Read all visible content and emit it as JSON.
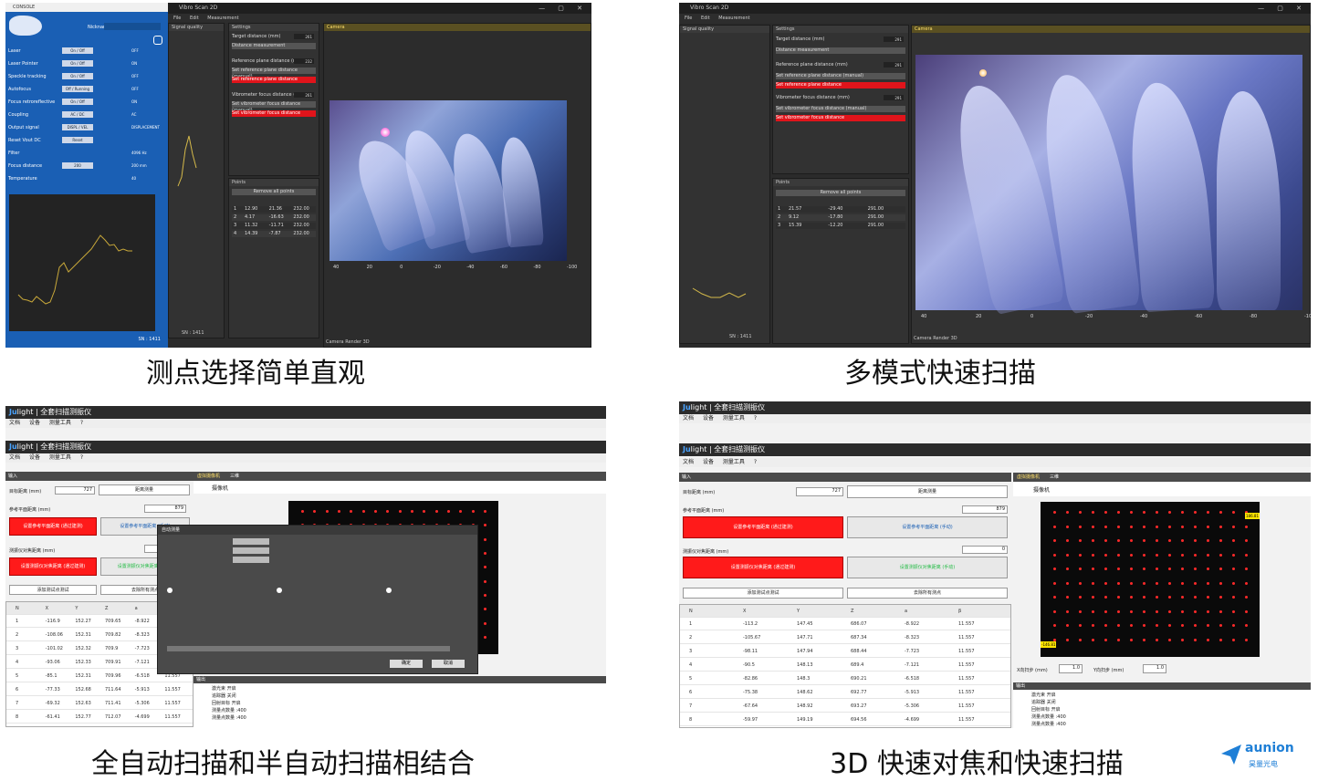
{
  "captions": {
    "top_left": "测点选择简单直观",
    "top_right": "多模式快速扫描",
    "bottom_left": "全自动扫描和半自动扫描相结合",
    "bottom_right": "3D  快速对焦和快速扫描"
  },
  "brand": {
    "name": "aunion",
    "sub": "昊量光电",
    "color": "#1f7fd6"
  },
  "vibro": {
    "app_title": "Vibro Scan 2D",
    "console_title": "CONSOLE",
    "menu": [
      "File",
      "Edit",
      "Measurement"
    ],
    "signal_quality": "Signal quality",
    "settings": "Settings",
    "camera": "Camera",
    "target_distance": "Target distance (mm)",
    "target_value_1": "261",
    "target_value_2": "291",
    "distance_measurement": "Distance measurement",
    "ref_plane": "Reference plane distance (mm)",
    "ref_value_1": "232",
    "ref_value_2": "291",
    "set_ref_manual": "Set reference plane distance (manual)",
    "set_ref": "Set reference plane distance",
    "vib_focus": "Vibrometer focus distance (mm)",
    "vib_value_1": "261",
    "vib_value_2": "291",
    "set_vib_manual": "Set vibrometer focus distance (manual)",
    "set_vib": "Set vibrometer focus distance",
    "points": "Points",
    "remove_all": "Remove all points",
    "sn": "SN : 1411",
    "tabs": "Camera  Render 3D",
    "nickname": "Nickname",
    "console_rows": [
      {
        "label": "Laser",
        "btn": "On / Off",
        "state": "OFF"
      },
      {
        "label": "Laser Pointer",
        "btn": "On / Off",
        "state": "ON"
      },
      {
        "label": "Speckle tracking",
        "btn": "On / Off",
        "state": "OFF"
      },
      {
        "label": "Autofocus",
        "btn": "Off / Running",
        "state": "OFF"
      },
      {
        "label": "Focus retroreflective",
        "btn": "On / Off",
        "state": "ON"
      },
      {
        "label": "Coupling",
        "btn": "AC / DC",
        "state": "AC"
      },
      {
        "label": "Output signal",
        "btn": "DISPL / VEL",
        "state": "DISPLACEMENT"
      },
      {
        "label": "Reset Vout DC",
        "btn": "Reset",
        "state": ""
      },
      {
        "label": "Filter",
        "btn": "",
        "state": "4096 Hz"
      },
      {
        "label": "Focus distance",
        "btn": "200",
        "state": "200 mm"
      },
      {
        "label": "Temperature",
        "btn": "",
        "state": "40"
      }
    ],
    "points_rows_1": [
      [
        "1",
        "12.90",
        "21.36",
        "232.00"
      ],
      [
        "2",
        "4.17",
        "-16.63",
        "232.00"
      ],
      [
        "3",
        "11.32",
        "-11.71",
        "232.00"
      ],
      [
        "4",
        "14.39",
        "-7.87",
        "232.00"
      ]
    ],
    "points_rows_2": [
      [
        "1",
        "21.57",
        "-29.40",
        "291.00"
      ],
      [
        "2",
        "9.12",
        "-17.80",
        "291.00"
      ],
      [
        "3",
        "15.39",
        "-12.20",
        "291.00"
      ]
    ],
    "axis_ticks": [
      "40",
      "20",
      "0",
      "-20",
      "-40",
      "-60",
      "-80",
      "-100"
    ]
  },
  "julight": {
    "brand_a": "Ju",
    "brand_b": "light",
    "title": "全套扫描测振仪",
    "menu": [
      "文档",
      "设备",
      "测量工具",
      "?"
    ],
    "pane_label": "输入",
    "target_distance": "目标距离 (mm)",
    "target_value": "727",
    "distance_btn": "距离测量",
    "ref_plane": "参考平面距离 (mm)",
    "ref_value": "879",
    "set_ref_auto": "设置参考平面距离 (通过建测)",
    "set_ref_manual": "设置参考平面距离 (手动)",
    "vib_focus": "测振仪对焦距离 (mm)",
    "vib_value": "0",
    "set_vib_auto": "设置测振仪对焦距离 (通过建测)",
    "set_vib_manual": "设置测振仪对焦距离 (手动)",
    "add_point": "添加测试点测试",
    "remove_all": "去除所有测点",
    "camera_tab": "虚拟摄像机",
    "tab_3d": "三维",
    "camera_label": "摄像机",
    "output_label": "输出",
    "x_step": "X向扫步 (mm)",
    "x_step_value": "1.0",
    "y_step": "Y向扫步 (mm)",
    "y_step_value": "1.0",
    "grid_readout": "186.81",
    "grid_readout_2": "-146.81",
    "columns": [
      "N",
      "X",
      "Y",
      "Z",
      "a",
      "β"
    ],
    "rows_left": [
      [
        "1",
        "-116.9",
        "152.27",
        "709.65",
        "-8.922",
        ""
      ],
      [
        "2",
        "-108.06",
        "152.31",
        "709.82",
        "-8.323",
        ""
      ],
      [
        "3",
        "-101.02",
        "152.32",
        "709.9",
        "-7.723",
        ""
      ],
      [
        "4",
        "-93.06",
        "152.33",
        "709.91",
        "-7.121",
        ""
      ],
      [
        "5",
        "-85.1",
        "152.31",
        "709.96",
        "-6.518",
        "11.557"
      ],
      [
        "6",
        "-77.33",
        "152.68",
        "711.64",
        "-5.913",
        "11.557"
      ],
      [
        "7",
        "-69.32",
        "152.63",
        "711.41",
        "-5.306",
        "11.557"
      ],
      [
        "8",
        "-61.41",
        "152.77",
        "712.07",
        "-4.699",
        "11.557"
      ]
    ],
    "rows_right": [
      [
        "1",
        "-113.2",
        "147.45",
        "686.07",
        "-8.922",
        "11.557"
      ],
      [
        "2",
        "-105.67",
        "147.71",
        "687.34",
        "-8.323",
        "11.557"
      ],
      [
        "3",
        "-98.11",
        "147.94",
        "688.44",
        "-7.723",
        "11.557"
      ],
      [
        "4",
        "-90.5",
        "148.13",
        "689.4",
        "-7.121",
        "11.557"
      ],
      [
        "5",
        "-82.86",
        "148.3",
        "690.21",
        "-6.518",
        "11.557"
      ],
      [
        "6",
        "-75.38",
        "148.62",
        "692.77",
        "-5.913",
        "11.557"
      ],
      [
        "7",
        "-67.64",
        "148.92",
        "693.27",
        "-5.306",
        "11.557"
      ],
      [
        "8",
        "-59.97",
        "149.19",
        "694.56",
        "-4.699",
        "11.557"
      ]
    ],
    "output_lines": [
      "激光束 开启",
      "追踪器 关闭",
      "回射目标 开启",
      "测量点数量 :400",
      "测量点数量 :400"
    ],
    "dialog_title": "自动测量",
    "dialog_ok": "确定",
    "dialog_cancel": "取消"
  }
}
